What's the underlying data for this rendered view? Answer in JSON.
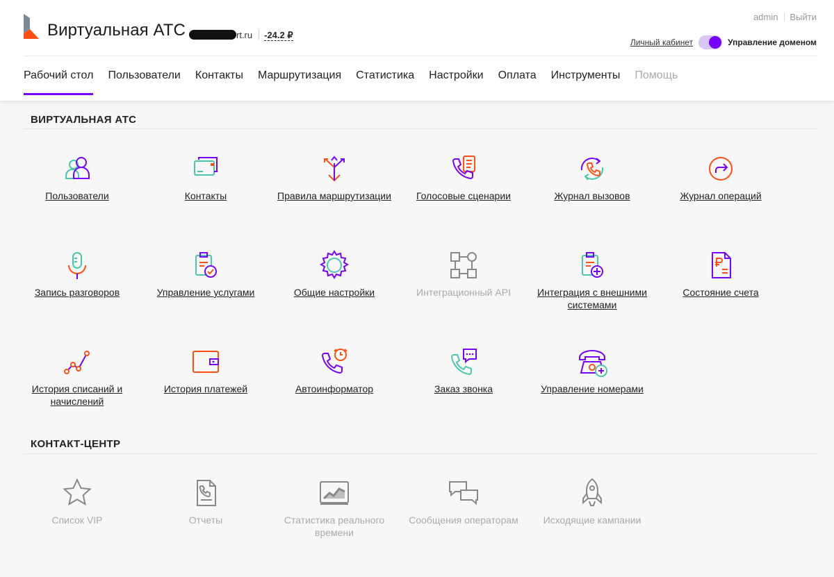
{
  "header": {
    "title": "Виртуальная АТС",
    "domain_suffix": "rt.ru",
    "balance": "-24.2 ₽",
    "user": "admin",
    "logout": "Выйти",
    "cabinet_link": "Личный кабинет",
    "domain_management": "Управление доменом",
    "toggle_on": true
  },
  "colors": {
    "accent": "#7700ff",
    "orange": "#ff4f12",
    "teal": "#48c7b0",
    "disabled": "#aaaaaa"
  },
  "nav": [
    {
      "label": "Рабочий стол",
      "active": true
    },
    {
      "label": "Пользователи"
    },
    {
      "label": "Контакты"
    },
    {
      "label": "Маршрутизация"
    },
    {
      "label": "Статистика"
    },
    {
      "label": "Настройки"
    },
    {
      "label": "Оплата"
    },
    {
      "label": "Инструменты"
    },
    {
      "label": "Помощь",
      "disabled": true
    }
  ],
  "sections": {
    "vats": {
      "title": "ВИРТУАЛЬНАЯ АТС",
      "tiles": [
        {
          "label": "Пользователи",
          "icon": "users-icon"
        },
        {
          "label": "Контакты",
          "icon": "contacts-icon"
        },
        {
          "label": "Правила маршрутизации",
          "icon": "routing-icon"
        },
        {
          "label": "Голосовые сценарии",
          "icon": "voice-scenario-icon"
        },
        {
          "label": "Журнал вызовов",
          "icon": "call-log-icon"
        },
        {
          "label": "Журнал операций",
          "icon": "operation-log-icon"
        },
        {
          "label": "Запись разговоров",
          "icon": "microphone-icon"
        },
        {
          "label": "Управление услугами",
          "icon": "services-icon"
        },
        {
          "label": "Общие настройки",
          "icon": "gear-icon"
        },
        {
          "label": "Интеграционный API",
          "icon": "api-icon",
          "disabled": true
        },
        {
          "label": "Интеграция с внешними системами",
          "icon": "integration-icon"
        },
        {
          "label": "Состояние счета",
          "icon": "invoice-icon"
        },
        {
          "label": "История списаний и начислений",
          "icon": "history-chart-icon"
        },
        {
          "label": "История платежей",
          "icon": "wallet-icon"
        },
        {
          "label": "Автоинформатор",
          "icon": "autoinformer-icon"
        },
        {
          "label": "Заказ звонка",
          "icon": "callback-icon"
        },
        {
          "label": "Управление номерами",
          "icon": "number-management-icon"
        }
      ]
    },
    "cc": {
      "title": "КОНТАКТ-ЦЕНТР",
      "tiles": [
        {
          "label": "Список VIP",
          "icon": "star-icon",
          "disabled": true
        },
        {
          "label": "Отчеты",
          "icon": "reports-icon",
          "disabled": true
        },
        {
          "label": "Статистика реального времени",
          "icon": "realtime-stats-icon",
          "disabled": true
        },
        {
          "label": "Сообщения операторам",
          "icon": "messages-icon",
          "disabled": true
        },
        {
          "label": "Исходящие кампании",
          "icon": "rocket-icon",
          "disabled": true
        }
      ]
    }
  }
}
